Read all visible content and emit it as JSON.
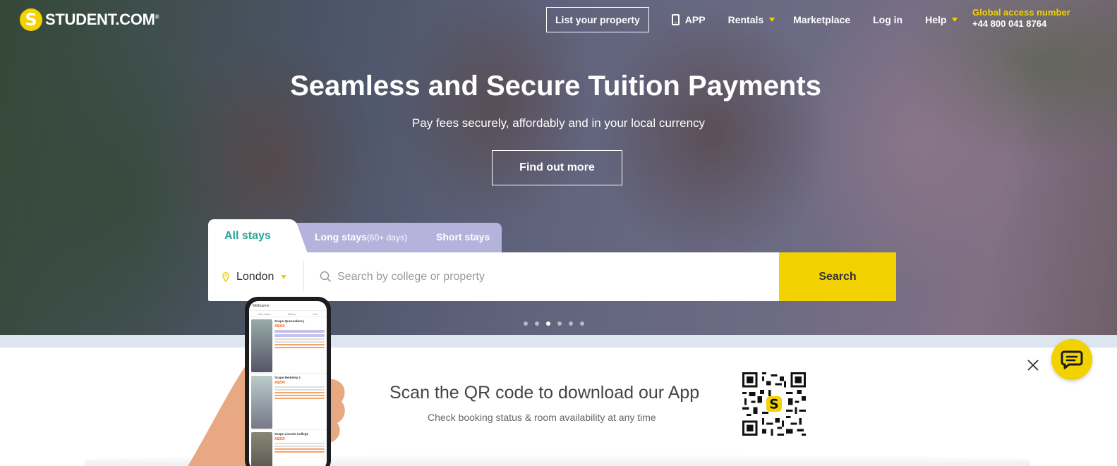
{
  "brand": {
    "name": "STUDENT.COM",
    "trademark": "®",
    "logo_letter": "S"
  },
  "nav": {
    "list_property": "List your property",
    "app": "APP",
    "rentals": "Rentals",
    "marketplace": "Marketplace",
    "login": "Log in",
    "help": "Help",
    "global_label": "Global access number",
    "global_number": "+44 800 041 8764"
  },
  "hero": {
    "headline": "Seamless and Secure Tuition Payments",
    "subline": "Pay fees securely, affordably and in your local currency",
    "cta": "Find out more",
    "carousel": {
      "count": 6,
      "active_index": 2
    }
  },
  "search": {
    "tabs": {
      "all": "All stays",
      "long": "Long stays",
      "long_note": "(60+ days)",
      "short": "Short stays",
      "active": "all"
    },
    "city": "London",
    "placeholder": "Search by college or property",
    "button": "Search"
  },
  "app_banner": {
    "title": "Scan the QR code to download our App",
    "subtitle": "Check booking status & room availability at any time"
  },
  "phone_mockup": {
    "header": "Melbourne",
    "filters": [
      "Univ cities",
      "Filters",
      "Sort"
    ],
    "listings": [
      {
        "name": "Scape Queensberry",
        "price": "A$359"
      },
      {
        "name": "Scape Berkeley 1",
        "price": "A$299"
      },
      {
        "name": "Scape Lincoln College",
        "price": "A$329"
      }
    ]
  },
  "colors": {
    "brand_yellow": "#f2d200",
    "tab_teal": "#26a69a",
    "tab_lavender": "#b5b2dc"
  },
  "icons": [
    "logo-icon",
    "phone-icon",
    "chevron-down-icon",
    "location-pin-icon",
    "search-icon",
    "close-icon",
    "chat-icon",
    "qr-code-icon"
  ]
}
